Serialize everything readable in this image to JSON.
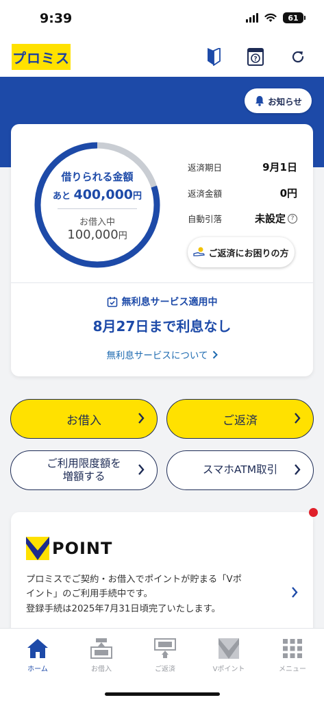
{
  "status_bar": {
    "time": "9:39",
    "battery": "61"
  },
  "header": {
    "logo_text": "プロミス",
    "icons": [
      "beginner-mark-icon",
      "help-book-icon",
      "refresh-icon"
    ]
  },
  "notice_button": {
    "label": "お知らせ"
  },
  "loan_summary": {
    "gauge_label": "借りられる金額",
    "remaining_prefix": "あと",
    "remaining_amount": "400,000",
    "remaining_unit": "円",
    "borrowed_label": "お借入中",
    "borrowed_amount": "100,000",
    "borrowed_unit": "円",
    "gauge_fraction_available": 0.8
  },
  "repayment_info": [
    {
      "key": "返済期日",
      "value": "9月1日"
    },
    {
      "key": "返済金額",
      "value": "0円"
    },
    {
      "key": "自動引落",
      "value": "未設定"
    }
  ],
  "trouble_button": {
    "label": "ご返済にお困りの方"
  },
  "no_interest": {
    "status": "無利息サービス適用中",
    "date_text": "8月27日まで利息なし",
    "link": "無利息サービスについて"
  },
  "actions": {
    "borrow": "お借入",
    "repay": "ご返済",
    "increase_line1": "ご利用限度額を",
    "increase_line2": "増額する",
    "atm": "スマホATM取引"
  },
  "vpoint": {
    "logo_text": "POINT",
    "line1": "プロミスでご契約・お借入でポイントが貯まる「Vポ",
    "line2": "イント」のご利用手続中です。",
    "line3": "登録手続は2025年7月31日頃完了いたします。"
  },
  "tabbar": {
    "items": [
      {
        "label": "ホーム",
        "active": true
      },
      {
        "label": "お借入",
        "active": false
      },
      {
        "label": "ご返済",
        "active": false
      },
      {
        "label": "Vポイント",
        "active": false
      },
      {
        "label": "メニュー",
        "active": false
      }
    ]
  },
  "colors": {
    "brand_blue": "#1d4aa8",
    "brand_yellow": "#ffe100",
    "navy": "#1d2b55"
  }
}
